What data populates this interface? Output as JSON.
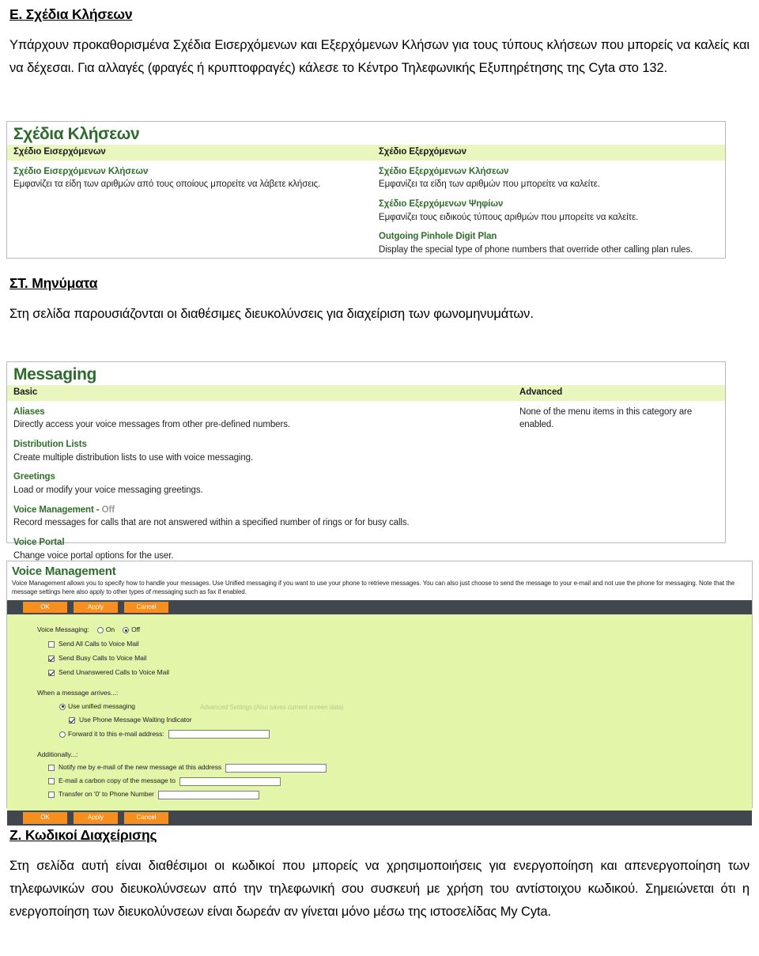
{
  "sections": {
    "calling_plans": {
      "heading": "Ε. Σχέδια Κλήσεων",
      "paragraph": "Υπάρχουν προκαθορισμένα Σχέδια Εισερχόμενων και Εξερχόμενων Κλήσων για τους τύπους κλήσεων που μπορείς να καλείς και να δέχεσαι. Για αλλαγές (φραγές ή κρυπτοφραγές) κάλεσε το Κέντρο Τηλεφωνικής Εξυπηρέτησης της Cyta στο 132."
    },
    "messages": {
      "heading": "ΣΤ. Μηνύματα",
      "paragraph": "Στη σελίδα παρουσιάζονται οι διαθέσιμες διευκολύνσεις για διαχείριση των φωνομηνυμάτων."
    },
    "admin_codes": {
      "heading": "Ζ. Κωδικοί Διαχείρισης",
      "paragraph": "Στη σελίδα αυτή είναι διαθέσιμοι οι κωδικοί που μπορείς να χρησιμοποιήσεις για ενεργοποίηση και απενεργοποίηση των τηλεφωνικών σου διευκολύνσεων από την τηλεφωνική σου συσκευή με χρήση του αντίστοιχου κωδικού. Σημειώνεται ότι η ενεργοποίηση των διευκολύνσεων είναι δωρεάν αν γίνεται μόνο μέσω της ιστοσελίδας My Cyta."
    }
  },
  "calling_plans_screenshot": {
    "title": "Σχέδια Κλήσεων",
    "left_column": {
      "header": "Σχέδιο Εισερχόμενων",
      "entries": [
        {
          "title": "Σχέδιο Εισερχόμενων Κλήσεων",
          "desc": "Εμφανίζει τα είδη των αριθμών από τους οποίους μπορείτε να λάβετε κλήσεις."
        }
      ]
    },
    "right_column": {
      "header": "Σχέδιο Εξερχόμενων",
      "entries": [
        {
          "title": "Σχέδιο Εξερχόμενων Κλήσεων",
          "desc": "Εμφανίζει τα είδη των αριθμών που μπορείτε να καλείτε."
        },
        {
          "title": "Σχέδιο Εξερχόμενων Ψηφίων",
          "desc": "Εμφανίζει τους ειδικούς τύπους αριθμών που μπορείτε να καλείτε."
        },
        {
          "title": "Outgoing Pinhole Digit Plan",
          "desc": "Display the special type of phone numbers that override other calling plan rules."
        }
      ]
    }
  },
  "messaging_screenshot": {
    "title": "Messaging",
    "left_column": {
      "header": "Basic",
      "entries": [
        {
          "title": "Aliases",
          "desc": "Directly access your voice messages from other pre-defined numbers."
        },
        {
          "title": "Distribution Lists",
          "desc": "Create multiple distribution lists to use with voice messaging."
        },
        {
          "title": "Greetings",
          "desc": "Load or modify your voice messaging greetings."
        },
        {
          "title": "Voice Management - ",
          "status": "Off",
          "desc": "Record messages for calls that are not answered within a specified number of rings or for busy calls."
        },
        {
          "title": "Voice Portal",
          "desc": "Change voice portal options for the user."
        }
      ]
    },
    "right_column": {
      "header": "Advanced",
      "note": "None of the menu items in this category are enabled."
    }
  },
  "voice_management_screenshot": {
    "title": "Voice Management",
    "description": "Voice Management allows you to specify how to handle your messages. Use Unified messaging if you want to use your phone to retrieve messages. You can also just choose to send the message to your e-mail and not use the phone for messaging. Note that the message settings here also apply to other types of messaging such as fax if enabled.",
    "buttons": {
      "ok": "OK",
      "apply": "Apply",
      "cancel": "Cancel"
    },
    "voice_messaging": {
      "label": "Voice Messaging:",
      "option_on": "On",
      "option_off": "Off",
      "selected": "Off",
      "checkboxes": [
        {
          "label": "Send All Calls to Voice Mail",
          "checked": false
        },
        {
          "label": "Send Busy Calls to Voice Mail",
          "checked": true
        },
        {
          "label": "Send Unanswered Calls to Voice Mail",
          "checked": true
        }
      ]
    },
    "when_arrives": {
      "label": "When a message arrives...:",
      "unified_option": "Use unified messaging",
      "unified_selected": true,
      "mwi_label": "Use Phone Message Waiting Indicator",
      "mwi_checked": true,
      "forward_option": "Forward it to this e-mail address:",
      "forward_selected": false,
      "forward_value": "",
      "advanced_note": "Advanced Settings (Also saves current screen data)"
    },
    "additionally": {
      "label": "Additionally...:",
      "rows": [
        {
          "label": "Notify me by e-mail of the new message at this address",
          "checked": false,
          "value": ""
        },
        {
          "label": "E-mail a carbon copy of the message to",
          "checked": false,
          "value": ""
        },
        {
          "label": "Transfer on '0' to Phone Number",
          "checked": false,
          "value": ""
        }
      ]
    }
  }
}
